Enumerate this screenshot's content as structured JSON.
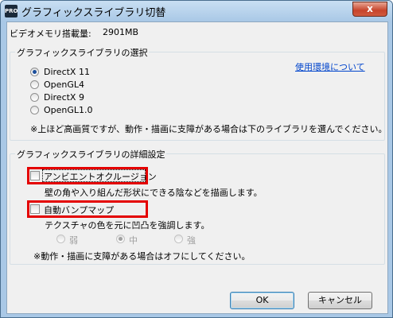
{
  "window": {
    "title": "グラフィックスライブラリ切替",
    "icon_label": "PRO",
    "close_label": "x"
  },
  "vram": {
    "label": "ビデオメモリ搭載量:",
    "value": "2901MB"
  },
  "library_group": {
    "title": "グラフィックスライブラリの選択",
    "help_link": "使用環境について",
    "options": [
      {
        "label": "DirectX 11",
        "selected": true
      },
      {
        "label": "OpenGL4",
        "selected": false
      },
      {
        "label": "DirectX 9",
        "selected": false
      },
      {
        "label": "OpenGL1.0",
        "selected": false
      }
    ],
    "note": "※上ほど高画質ですが、動作・描画に支障がある場合は下のライブラリを選んでください。"
  },
  "detail_group": {
    "title": "グラフィックスライブラリの詳細設定",
    "ambient_occlusion": {
      "label": "アンビエントオクルージョン",
      "checked": false,
      "description": "壁の角や入り組んだ形状にできる陰などを描画します。"
    },
    "bump_map": {
      "label": "自動バンプマップ",
      "checked": false,
      "description": "テクスチャの色を元に凹凸を強調します。"
    },
    "strength": [
      {
        "label": "弱",
        "selected": false
      },
      {
        "label": "中",
        "selected": true
      },
      {
        "label": "強",
        "selected": false
      }
    ],
    "note": "※動作・描画に支障がある場合はオフにしてください。"
  },
  "buttons": {
    "ok": "OK",
    "cancel": "キャンセル"
  }
}
